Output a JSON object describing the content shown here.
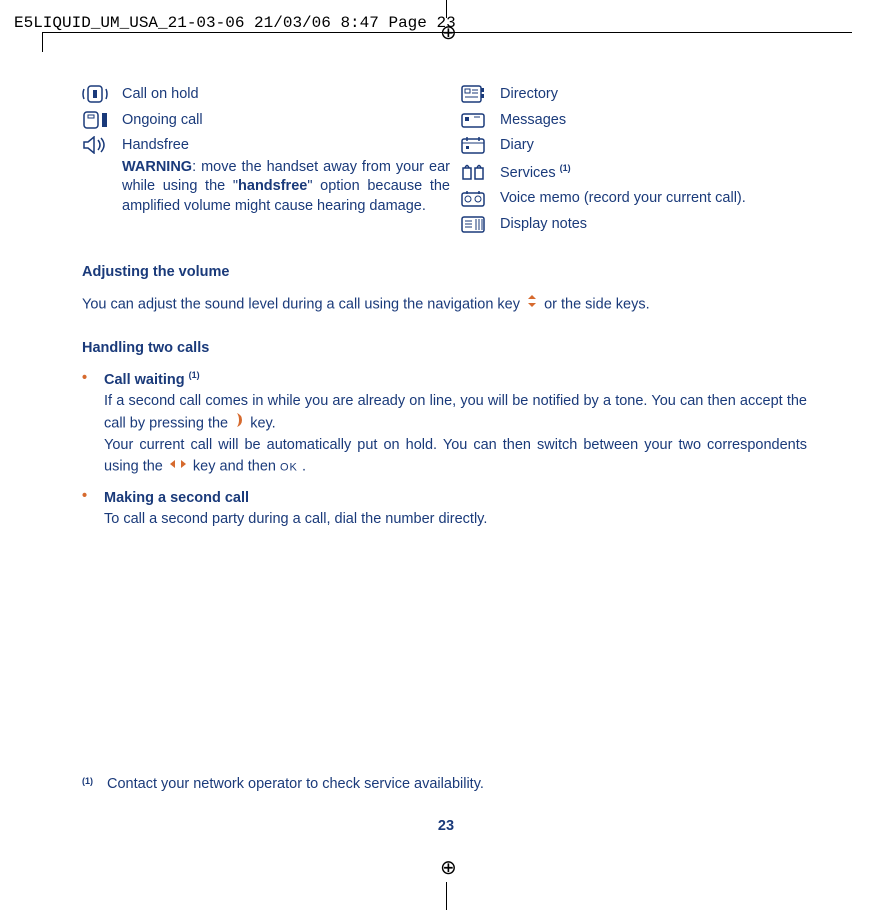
{
  "header": "E5LIQUID_UM_USA_21-03-06  21/03/06  8:47  Page 23",
  "left_items": [
    {
      "label": "Call on hold"
    },
    {
      "label": "Ongoing call"
    },
    {
      "label": "Handsfree"
    }
  ],
  "handsfree_warning": {
    "prefix": "WARNING",
    "text_a": ": move the handset away from your ear while using the \"",
    "bold": "handsfree",
    "text_b": "\" option because the amplified volume might cause hearing damage."
  },
  "right_items": [
    {
      "label": "Directory"
    },
    {
      "label": "Messages"
    },
    {
      "label": "Diary"
    },
    {
      "label": "Services ",
      "sup": "(1)"
    },
    {
      "label": "Voice memo (record your current call)."
    },
    {
      "label": "Display notes"
    }
  ],
  "sec1_title": "Adjusting the volume",
  "sec1_body_a": "You can adjust the sound level during a call using the navigation key ",
  "sec1_body_b": " or the side keys.",
  "sec2_title": "Handling two calls",
  "bullet1": {
    "title": "Call waiting ",
    "sup": "(1)",
    "line1_a": "If a second call comes in while you are already on line, you will be notified by a tone. You can then accept the call by pressing the ",
    "line1_b": " key.",
    "line2_a": "Your current call will be automatically put on hold. You can then switch between your two correspondents using the ",
    "line2_b": " key and then ",
    "line2_c": "."
  },
  "bullet2": {
    "title": "Making a second call",
    "body": "To call a second party during a call, dial the number directly."
  },
  "footnote": {
    "sup": "(1)",
    "text": "Contact your network operator to check service availability."
  },
  "pagenum": "23"
}
